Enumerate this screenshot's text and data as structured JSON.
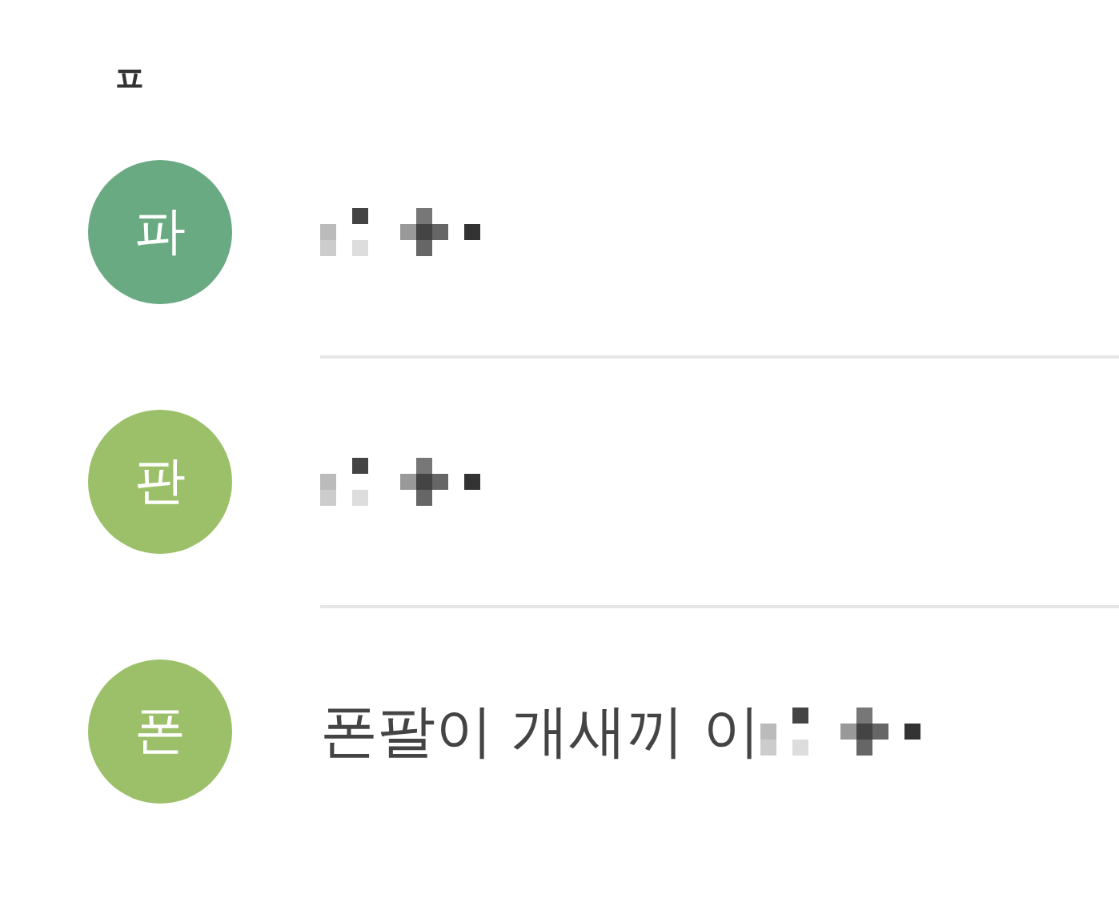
{
  "section_header": "ㅍ",
  "contacts": [
    {
      "avatar": "파",
      "color": "#6aaa82",
      "name_redacted": true
    },
    {
      "avatar": "판",
      "color": "#9cc069",
      "name_redacted": true
    },
    {
      "avatar": "폰",
      "color": "#9cc069",
      "name": "폰팔이 개새끼 이",
      "name_redacted": true
    }
  ]
}
